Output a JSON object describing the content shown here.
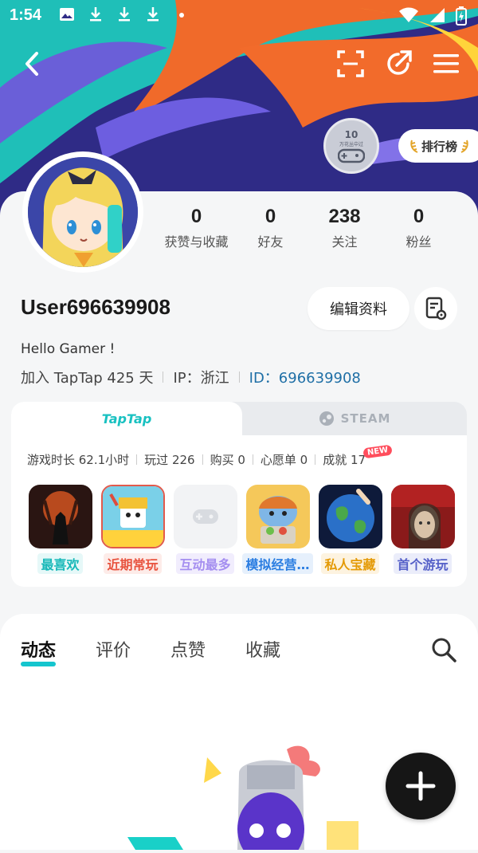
{
  "status_bar": {
    "time": "1:54"
  },
  "header": {
    "badge_number": "10",
    "badge_caption": "万花丛中过",
    "rank_label": "排行榜"
  },
  "profile": {
    "stats": [
      {
        "value": "0",
        "label": "获赞与收藏"
      },
      {
        "value": "0",
        "label": "好友"
      },
      {
        "value": "238",
        "label": "关注"
      },
      {
        "value": "0",
        "label": "粉丝"
      }
    ],
    "username": "User696639908",
    "edit_label": "编辑资料",
    "bio": "Hello Gamer !",
    "join_text": "加入 TapTap 425 天",
    "ip_text": "IP：浙江",
    "id_text": "ID：696639908"
  },
  "games_panel": {
    "tab_taptap": "TapTap",
    "tab_steam": "STEAM",
    "stats": [
      "游戏时长 62.1小时",
      "玩过 226",
      "购买 0",
      "心愿单 0",
      "成就 17"
    ],
    "new_badge": "NEW",
    "games": [
      {
        "caption": "最喜欢",
        "color": "#17b8b8",
        "bg": "#e6f8f8"
      },
      {
        "caption": "近期常玩",
        "color": "#e8533f",
        "bg": "#fdece9"
      },
      {
        "caption": "互动最多",
        "color": "#a58ff0",
        "bg": "#f1edfd"
      },
      {
        "caption": "模拟经营…",
        "color": "#2a7de1",
        "bg": "#e6f0fc"
      },
      {
        "caption": "私人宝藏",
        "color": "#e49a06",
        "bg": "#fdf3e0"
      },
      {
        "caption": "首个游玩",
        "color": "#5560c8",
        "bg": "#ebedfa"
      }
    ]
  },
  "content_tabs": [
    "动态",
    "评价",
    "点赞",
    "收藏"
  ]
}
